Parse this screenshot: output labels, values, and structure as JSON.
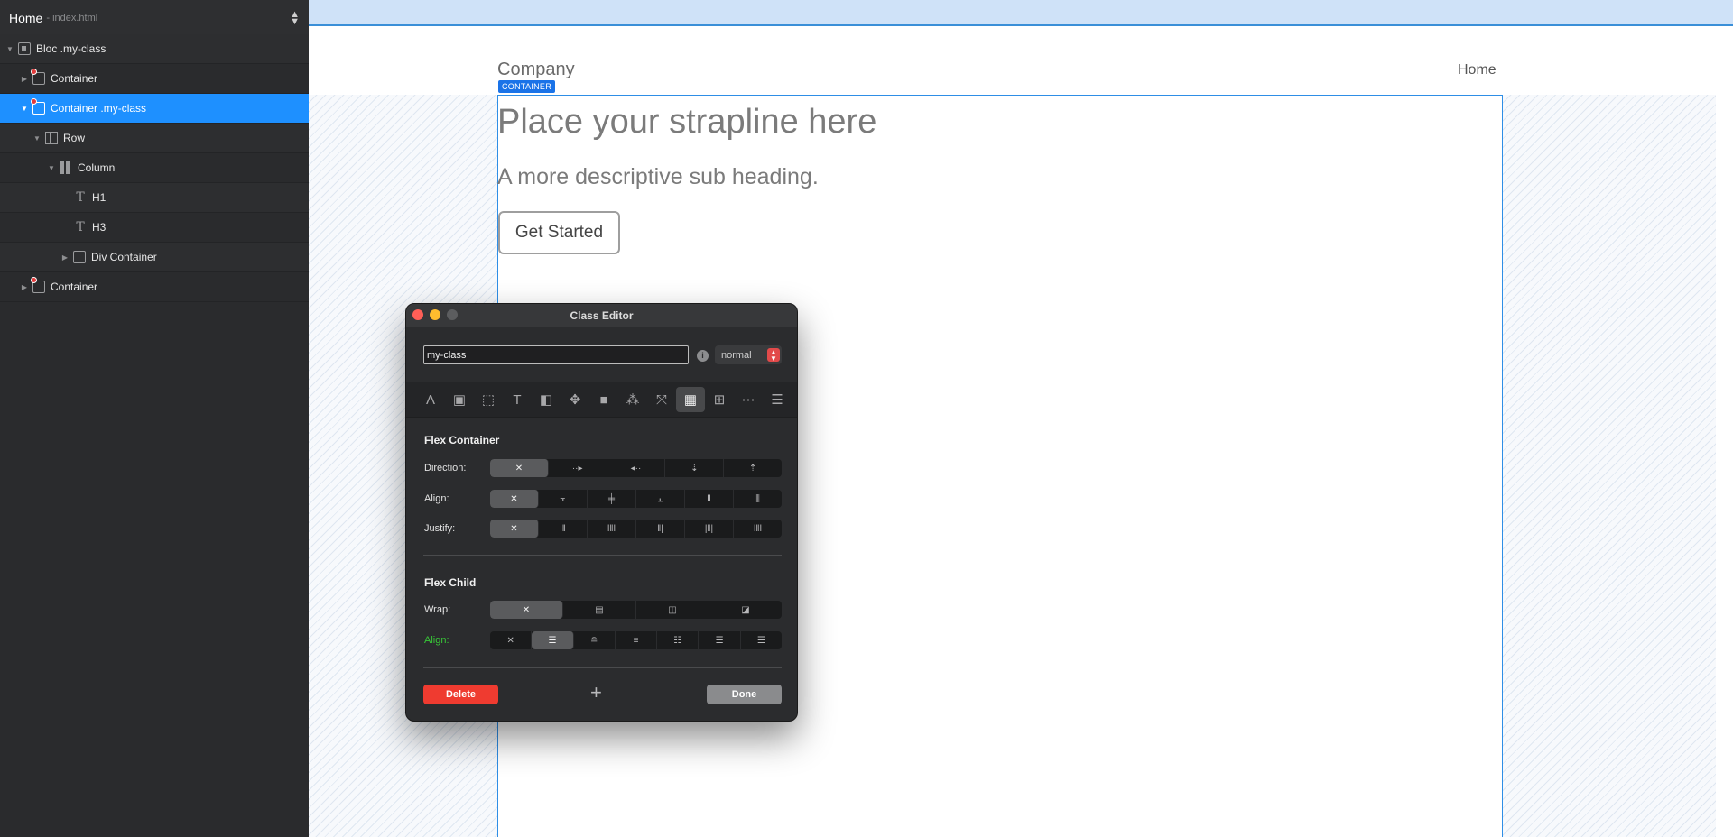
{
  "sidebar": {
    "title": "Home",
    "subtitle": "- index.html",
    "tree": [
      {
        "label": "Bloc .my-class",
        "icon": "bloc-icon"
      },
      {
        "label": "Container",
        "icon": "container-icon"
      },
      {
        "label": "Container .my-class",
        "icon": "container-icon"
      },
      {
        "label": "Row",
        "icon": "row-icon"
      },
      {
        "label": "Column",
        "icon": "column-icon"
      },
      {
        "label": "H1",
        "icon": "text-icon"
      },
      {
        "label": "H3",
        "icon": "text-icon"
      },
      {
        "label": "Div Container",
        "icon": "div-icon"
      },
      {
        "label": "Container",
        "icon": "container-icon"
      }
    ]
  },
  "canvas": {
    "company": "Company",
    "nav_home": "Home",
    "container_badge": "CONTAINER",
    "h1": "Place your strapline here",
    "h3": "A more descriptive sub heading.",
    "button": "Get Started"
  },
  "editor": {
    "title": "Class Editor",
    "class_name": "my-class",
    "state": "normal",
    "info": "i",
    "flex_container_title": "Flex Container",
    "direction_label": "Direction:",
    "align_label": "Align:",
    "justify_label": "Justify:",
    "flex_child_title": "Flex Child",
    "wrap_label": "Wrap:",
    "child_align_label": "Align:",
    "delete": "Delete",
    "add": "+",
    "done": "Done",
    "none_glyph": "✕"
  },
  "colors": {
    "selection": "#1e90ff",
    "container_outline": "#2e8ee6",
    "delete": "#ef3b30",
    "active_label": "#37c837"
  }
}
